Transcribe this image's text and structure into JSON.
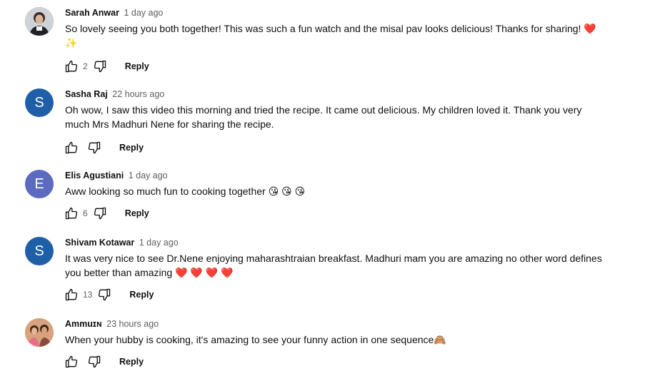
{
  "comments": [
    {
      "author": "Sarah Anwar",
      "time": "1 day ago",
      "text": "So lovely seeing you both together! This was such a fun watch and the misal pav looks delicious! Thanks for sharing! ❤️ ✨",
      "likes": "2",
      "reply_label": "Reply",
      "avatar": {
        "type": "photo",
        "icon": "user-photo-avatar"
      }
    },
    {
      "author": "Sasha Raj",
      "time": "22 hours ago",
      "text": "Oh wow, I saw this video this morning and tried the recipe. It came out delicious. My children loved it. Thank you very much Mrs Madhuri Nene for sharing the recipe.",
      "likes": "",
      "reply_label": "Reply",
      "avatar": {
        "type": "letter",
        "letter": "S",
        "color": "#1f5fa8"
      }
    },
    {
      "author": "Elis Agustiani",
      "time": "1 day ago",
      "text": "Aww looking so much fun to cooking together 😘 😘 😘",
      "likes": "6",
      "reply_label": "Reply",
      "avatar": {
        "type": "letter",
        "letter": "E",
        "color": "#5c6bc0"
      }
    },
    {
      "author": "Shivam Kotawar",
      "time": "1 day ago",
      "text": "It was very nice to see Dr.Nene enjoying maharashtraian breakfast. Madhuri mam you are amazing no other word defines you better than amazing ❤️ ❤️ ❤️ ❤️",
      "likes": "13",
      "reply_label": "Reply",
      "avatar": {
        "type": "letter",
        "letter": "S",
        "color": "#1f5fa8"
      }
    },
    {
      "author": "Ammuɪɴ",
      "time": "23 hours ago",
      "text": "When your hubby is cooking, it's amazing to see your funny action in one sequence🙈",
      "likes": "",
      "reply_label": "Reply",
      "avatar": {
        "type": "photo",
        "icon": "user-photo-avatar"
      }
    }
  ]
}
